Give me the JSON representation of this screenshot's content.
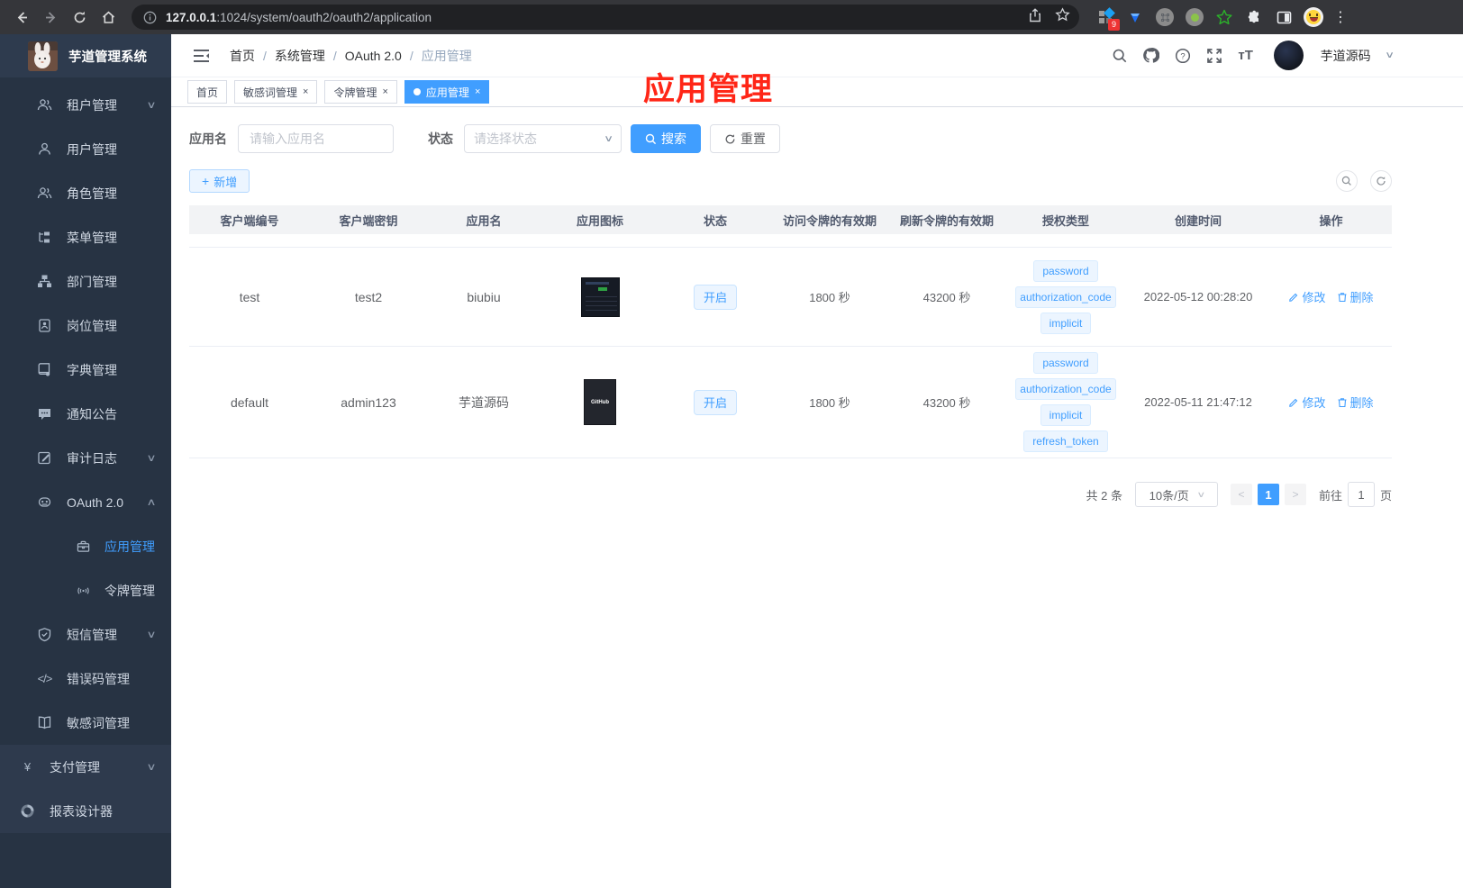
{
  "browser": {
    "url_host": "127.0.0.1",
    "url_path": ":1024/system/oauth2/oauth2/application",
    "extension_badge": "9",
    "icons": [
      "back-icon",
      "forward-icon",
      "reload-icon",
      "home-icon",
      "info-icon",
      "share-icon",
      "bookmark-star-icon",
      "extensions-puzzle-icon",
      "side-panel-icon",
      "profile-emoji-icon",
      "menu-dots-icon"
    ]
  },
  "sidebar": {
    "logo_title": "芋道管理系统",
    "items": [
      {
        "label": "租户管理",
        "arrow": "down"
      },
      {
        "label": "用户管理"
      },
      {
        "label": "角色管理"
      },
      {
        "label": "菜单管理"
      },
      {
        "label": "部门管理"
      },
      {
        "label": "岗位管理"
      },
      {
        "label": "字典管理"
      },
      {
        "label": "通知公告"
      },
      {
        "label": "审计日志",
        "arrow": "down"
      },
      {
        "label": "OAuth 2.0",
        "arrow": "up"
      },
      {
        "label": "应用管理",
        "child": true,
        "active": true
      },
      {
        "label": "令牌管理",
        "child": true
      },
      {
        "label": "短信管理",
        "arrow": "down"
      },
      {
        "label": "错误码管理"
      },
      {
        "label": "敏感词管理"
      },
      {
        "label": "支付管理",
        "arrow": "down",
        "section": "bottom"
      },
      {
        "label": "报表设计器",
        "section": "bottom"
      }
    ]
  },
  "header": {
    "breadcrumbs": [
      "首页",
      "系统管理",
      "OAuth 2.0",
      "应用管理"
    ],
    "separator": "/",
    "username": "芋道源码"
  },
  "annotation": {
    "title": "应用管理"
  },
  "tabs": [
    {
      "label": "首页",
      "closable": false,
      "active": false
    },
    {
      "label": "敏感词管理",
      "closable": true,
      "active": false
    },
    {
      "label": "令牌管理",
      "closable": true,
      "active": false
    },
    {
      "label": "应用管理",
      "closable": true,
      "active": true
    }
  ],
  "filters": {
    "name_label": "应用名",
    "name_placeholder": "请输入应用名",
    "status_label": "状态",
    "status_placeholder": "请选择状态",
    "search_label": "搜索",
    "reset_label": "重置",
    "add_label": "新增"
  },
  "table": {
    "headers": [
      "客户端编号",
      "客户端密钥",
      "应用名",
      "应用图标",
      "状态",
      "访问令牌的有效期",
      "刷新令牌的有效期",
      "授权类型",
      "创建时间",
      "操作"
    ],
    "edit_label": "修改",
    "delete_label": "删除",
    "rows": [
      {
        "client_id": "test",
        "secret": "test2",
        "name": "biubiu",
        "status": "开启",
        "access_ttl": "1800 秒",
        "refresh_ttl": "43200 秒",
        "grants": [
          "password",
          "authorization_code",
          "implicit"
        ],
        "created": "2022-05-12 00:28:20"
      },
      {
        "client_id": "default",
        "secret": "admin123",
        "name": "芋道源码",
        "status": "开启",
        "icon_text": "GitHub",
        "access_ttl": "1800 秒",
        "refresh_ttl": "43200 秒",
        "grants": [
          "password",
          "authorization_code",
          "implicit",
          "refresh_token"
        ],
        "created": "2022-05-11 21:47:12"
      }
    ]
  },
  "pagination": {
    "total": "共 2 条",
    "page_size": "10条/页",
    "current": "1",
    "goto_label": "前往",
    "goto_value": "1",
    "page_label": "页"
  },
  "colors": {
    "primary": "#409eff",
    "annotation_red": "#ff2617",
    "sidebar_bg": "#273343",
    "tag_bg": "#ecf5ff"
  }
}
